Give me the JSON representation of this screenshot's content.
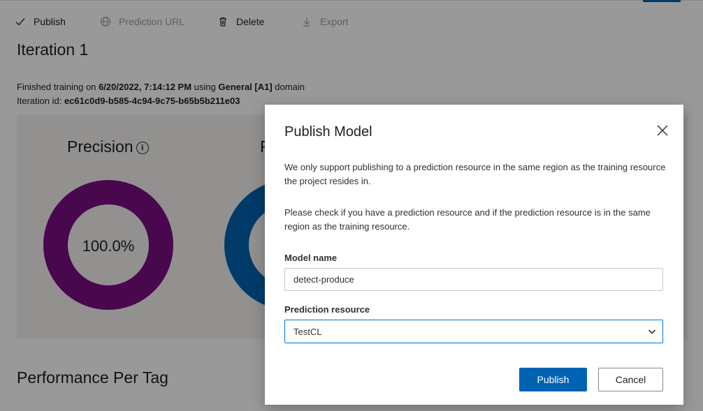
{
  "toolbar": {
    "publish": "Publish",
    "prediction_url": "Prediction URL",
    "delete": "Delete",
    "export": "Export"
  },
  "iteration": {
    "title": "Iteration 1",
    "finished_prefix": "Finished training on ",
    "finished_date": "6/20/2022, 7:14:12 PM",
    "using_text": " using ",
    "domain_name": "General [A1]",
    "domain_suffix": " domain",
    "id_label": "Iteration id: ",
    "id_value": "ec61c0d9-b585-4c94-9c75-b65b5b211e03"
  },
  "metrics": {
    "precision_label": "Precision",
    "precision_value": "100.0%",
    "recall_label_partial": "R",
    "precision_color": "#7a0c80",
    "recall_color": "#0063b1"
  },
  "performance_title": "Performance Per Tag",
  "dialog": {
    "title": "Publish Model",
    "paragraph1": "We only support publishing to a prediction resource in the same region as the training resource the project resides in.",
    "paragraph2": "Please check if you have a prediction resource and if the prediction resource is in the same region as the training resource.",
    "model_name_label": "Model name",
    "model_name_value": "detect-produce",
    "prediction_resource_label": "Prediction resource",
    "prediction_resource_value": "TestCL",
    "publish_button": "Publish",
    "cancel_button": "Cancel",
    "primary_color": "#0063b1"
  }
}
